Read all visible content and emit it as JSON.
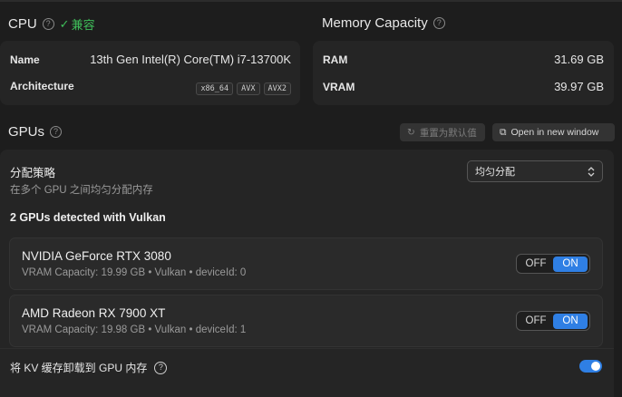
{
  "cpu": {
    "title": "CPU",
    "compat_label": "兼容",
    "name_label": "Name",
    "name_value": "13th Gen Intel(R) Core(TM) i7-13700K",
    "arch_label": "Architecture",
    "arch_tags": [
      "x86_64",
      "AVX",
      "AVX2"
    ]
  },
  "memory": {
    "title": "Memory Capacity",
    "ram_label": "RAM",
    "ram_value": "31.69 GB",
    "vram_label": "VRAM",
    "vram_value": "39.97 GB"
  },
  "gpus": {
    "title": "GPUs",
    "reset_label": "重置为默认值",
    "open_window_label": "Open in new window",
    "strategy_title": "分配策略",
    "strategy_desc": "在多个 GPU 之间均匀分配内存",
    "strategy_select": "均匀分配",
    "detected": "2 GPUs detected with Vulkan",
    "list": [
      {
        "name": "NVIDIA GeForce RTX 3080",
        "meta": "VRAM Capacity: 19.99 GB • Vulkan • deviceId: 0",
        "off_label": "OFF",
        "on_label": "ON"
      },
      {
        "name": "AMD Radeon RX 7900 XT",
        "meta": "VRAM Capacity: 19.98 GB • Vulkan • deviceId: 1",
        "off_label": "OFF",
        "on_label": "ON"
      }
    ],
    "offload_label": "将 KV 缓存卸载到 GPU 内存",
    "offload_enabled": true
  },
  "colors": {
    "accent": "#2f7fe4",
    "compat_green": "#3fbf5a",
    "background": "#1d1d1d",
    "card": "#252525"
  },
  "icons": [
    "help-icon",
    "check-icon",
    "reset-icon",
    "window-icon",
    "chevron-updown-icon"
  ]
}
